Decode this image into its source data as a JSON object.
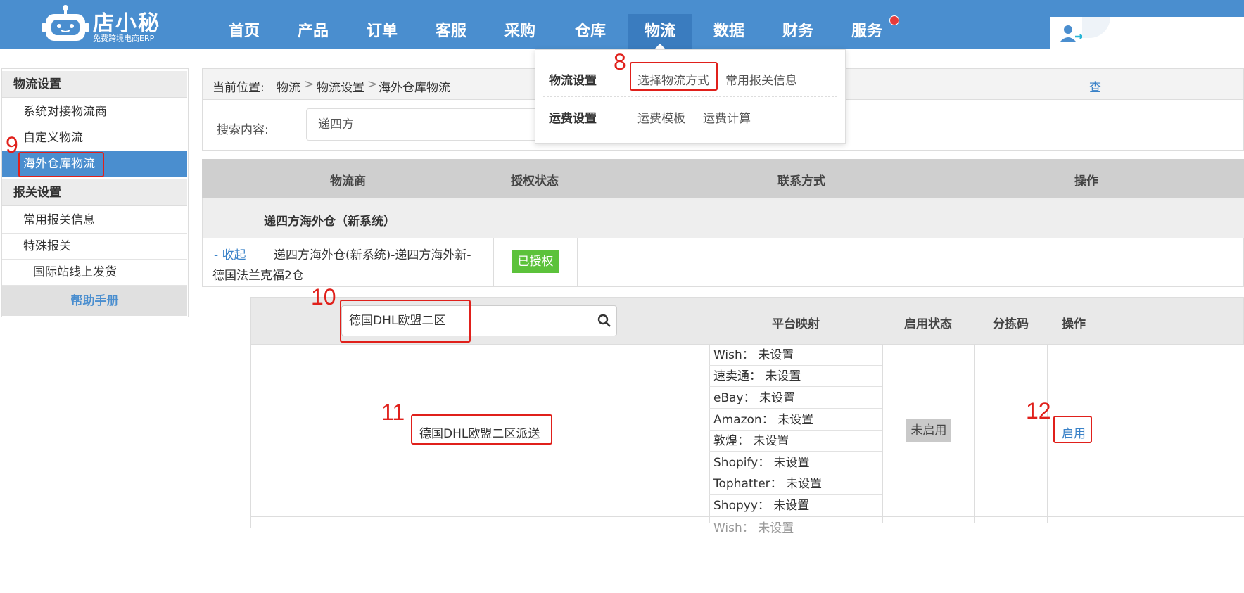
{
  "brand": {
    "name": "店小秘",
    "tagline": "免费跨境电商ERP"
  },
  "nav": {
    "items": [
      "首页",
      "产品",
      "订单",
      "客服",
      "采购",
      "仓库",
      "物流",
      "数据",
      "财务",
      "服务"
    ],
    "active": "物流"
  },
  "dropdown": {
    "group1_label": "物流设置",
    "group1_links": [
      "选择物流方式",
      "常用报关信息"
    ],
    "group2_label": "运费设置",
    "group2_links": [
      "运费模板",
      "运费计算"
    ]
  },
  "sidebar": {
    "section1": "物流设置",
    "items1": [
      "系统对接物流商",
      "自定义物流",
      "海外仓库物流"
    ],
    "section2": "报关设置",
    "items2": [
      "常用报关信息",
      "特殊报关",
      "国际站线上发货"
    ],
    "help": "帮助手册"
  },
  "breadcrumb": {
    "prefix": "当前位置:",
    "level1": "物流",
    "level2": "物流设置",
    "level3": "海外仓库物流",
    "right_link": "查"
  },
  "search": {
    "label": "搜索内容:",
    "value": "递四方"
  },
  "table1": {
    "headers": [
      "物流商",
      "授权状态",
      "联系方式",
      "操作"
    ],
    "group_title": "递四方海外仓（新系统）",
    "row": {
      "toggle": "- 收起",
      "name_line1": "递四方海外仓(新系统)-递四方海外新-",
      "name_line2": "德国法兰克福2仓",
      "status": "已授权"
    }
  },
  "table2": {
    "search_value": "德国DHL欧盟二区",
    "headers": [
      "平台映射",
      "启用状态",
      "分拣码",
      "操作"
    ],
    "method_name": "德国DHL欧盟二区派送",
    "mappings": [
      "Wish：  未设置",
      "速卖通：  未设置",
      "eBay：  未设置",
      "Amazon：  未设置",
      "敦煌：  未设置",
      "Shopify：  未设置",
      "Tophatter：  未设置",
      "Shopyy：  未设置",
      "Wish：  未设置"
    ],
    "status": "未启用",
    "action": "启用"
  },
  "annotations": [
    "8",
    "9",
    "10",
    "11",
    "12"
  ],
  "colors": {
    "header_blue": "#4a8ecf",
    "annotation_red": "#e0201b",
    "authorized_green": "#5cc23b"
  }
}
